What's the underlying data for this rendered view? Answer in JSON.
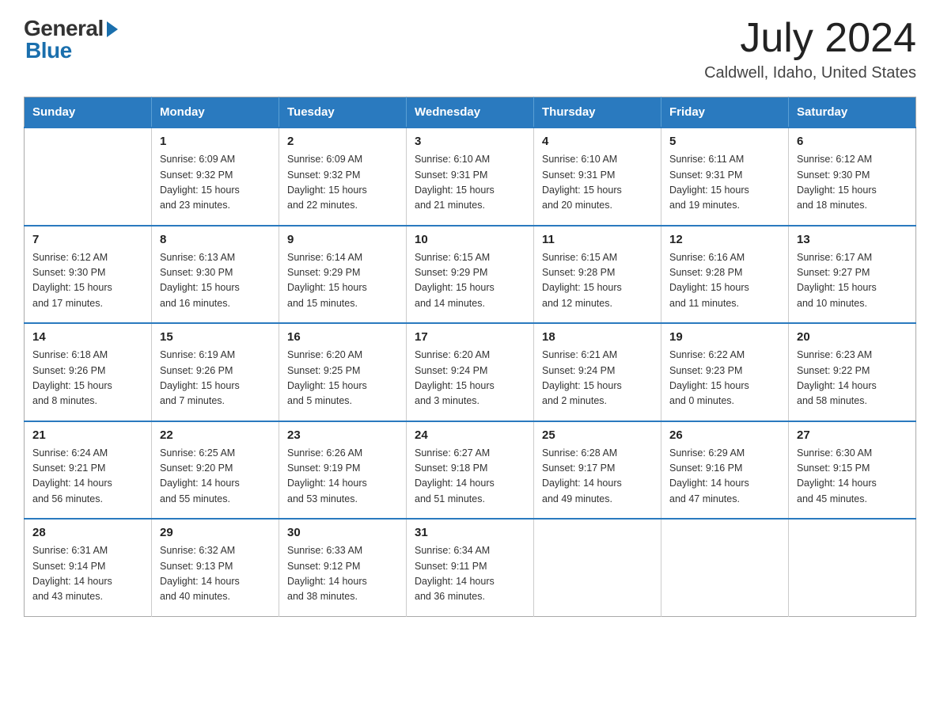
{
  "header": {
    "logo_general": "General",
    "logo_blue": "Blue",
    "month_title": "July 2024",
    "location": "Caldwell, Idaho, United States"
  },
  "weekdays": [
    "Sunday",
    "Monday",
    "Tuesday",
    "Wednesday",
    "Thursday",
    "Friday",
    "Saturday"
  ],
  "weeks": [
    [
      {
        "day": "",
        "info": ""
      },
      {
        "day": "1",
        "info": "Sunrise: 6:09 AM\nSunset: 9:32 PM\nDaylight: 15 hours\nand 23 minutes."
      },
      {
        "day": "2",
        "info": "Sunrise: 6:09 AM\nSunset: 9:32 PM\nDaylight: 15 hours\nand 22 minutes."
      },
      {
        "day": "3",
        "info": "Sunrise: 6:10 AM\nSunset: 9:31 PM\nDaylight: 15 hours\nand 21 minutes."
      },
      {
        "day": "4",
        "info": "Sunrise: 6:10 AM\nSunset: 9:31 PM\nDaylight: 15 hours\nand 20 minutes."
      },
      {
        "day": "5",
        "info": "Sunrise: 6:11 AM\nSunset: 9:31 PM\nDaylight: 15 hours\nand 19 minutes."
      },
      {
        "day": "6",
        "info": "Sunrise: 6:12 AM\nSunset: 9:30 PM\nDaylight: 15 hours\nand 18 minutes."
      }
    ],
    [
      {
        "day": "7",
        "info": "Sunrise: 6:12 AM\nSunset: 9:30 PM\nDaylight: 15 hours\nand 17 minutes."
      },
      {
        "day": "8",
        "info": "Sunrise: 6:13 AM\nSunset: 9:30 PM\nDaylight: 15 hours\nand 16 minutes."
      },
      {
        "day": "9",
        "info": "Sunrise: 6:14 AM\nSunset: 9:29 PM\nDaylight: 15 hours\nand 15 minutes."
      },
      {
        "day": "10",
        "info": "Sunrise: 6:15 AM\nSunset: 9:29 PM\nDaylight: 15 hours\nand 14 minutes."
      },
      {
        "day": "11",
        "info": "Sunrise: 6:15 AM\nSunset: 9:28 PM\nDaylight: 15 hours\nand 12 minutes."
      },
      {
        "day": "12",
        "info": "Sunrise: 6:16 AM\nSunset: 9:28 PM\nDaylight: 15 hours\nand 11 minutes."
      },
      {
        "day": "13",
        "info": "Sunrise: 6:17 AM\nSunset: 9:27 PM\nDaylight: 15 hours\nand 10 minutes."
      }
    ],
    [
      {
        "day": "14",
        "info": "Sunrise: 6:18 AM\nSunset: 9:26 PM\nDaylight: 15 hours\nand 8 minutes."
      },
      {
        "day": "15",
        "info": "Sunrise: 6:19 AM\nSunset: 9:26 PM\nDaylight: 15 hours\nand 7 minutes."
      },
      {
        "day": "16",
        "info": "Sunrise: 6:20 AM\nSunset: 9:25 PM\nDaylight: 15 hours\nand 5 minutes."
      },
      {
        "day": "17",
        "info": "Sunrise: 6:20 AM\nSunset: 9:24 PM\nDaylight: 15 hours\nand 3 minutes."
      },
      {
        "day": "18",
        "info": "Sunrise: 6:21 AM\nSunset: 9:24 PM\nDaylight: 15 hours\nand 2 minutes."
      },
      {
        "day": "19",
        "info": "Sunrise: 6:22 AM\nSunset: 9:23 PM\nDaylight: 15 hours\nand 0 minutes."
      },
      {
        "day": "20",
        "info": "Sunrise: 6:23 AM\nSunset: 9:22 PM\nDaylight: 14 hours\nand 58 minutes."
      }
    ],
    [
      {
        "day": "21",
        "info": "Sunrise: 6:24 AM\nSunset: 9:21 PM\nDaylight: 14 hours\nand 56 minutes."
      },
      {
        "day": "22",
        "info": "Sunrise: 6:25 AM\nSunset: 9:20 PM\nDaylight: 14 hours\nand 55 minutes."
      },
      {
        "day": "23",
        "info": "Sunrise: 6:26 AM\nSunset: 9:19 PM\nDaylight: 14 hours\nand 53 minutes."
      },
      {
        "day": "24",
        "info": "Sunrise: 6:27 AM\nSunset: 9:18 PM\nDaylight: 14 hours\nand 51 minutes."
      },
      {
        "day": "25",
        "info": "Sunrise: 6:28 AM\nSunset: 9:17 PM\nDaylight: 14 hours\nand 49 minutes."
      },
      {
        "day": "26",
        "info": "Sunrise: 6:29 AM\nSunset: 9:16 PM\nDaylight: 14 hours\nand 47 minutes."
      },
      {
        "day": "27",
        "info": "Sunrise: 6:30 AM\nSunset: 9:15 PM\nDaylight: 14 hours\nand 45 minutes."
      }
    ],
    [
      {
        "day": "28",
        "info": "Sunrise: 6:31 AM\nSunset: 9:14 PM\nDaylight: 14 hours\nand 43 minutes."
      },
      {
        "day": "29",
        "info": "Sunrise: 6:32 AM\nSunset: 9:13 PM\nDaylight: 14 hours\nand 40 minutes."
      },
      {
        "day": "30",
        "info": "Sunrise: 6:33 AM\nSunset: 9:12 PM\nDaylight: 14 hours\nand 38 minutes."
      },
      {
        "day": "31",
        "info": "Sunrise: 6:34 AM\nSunset: 9:11 PM\nDaylight: 14 hours\nand 36 minutes."
      },
      {
        "day": "",
        "info": ""
      },
      {
        "day": "",
        "info": ""
      },
      {
        "day": "",
        "info": ""
      }
    ]
  ]
}
